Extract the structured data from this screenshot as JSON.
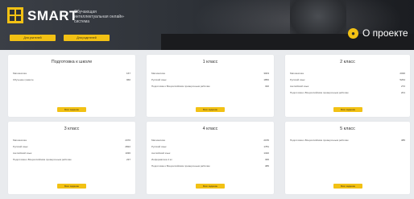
{
  "header": {
    "logo_text": "SMART",
    "logo_subtitle": "Обучающая интеллектуальная онлайн-система",
    "button_1": "Для учителей",
    "button_2": "Для родителей",
    "about_label": "О проекте",
    "about_icon": "eye-icon"
  },
  "cards": [
    {
      "title": "Подготовка к школе",
      "rows": [
        {
          "label": "Математика",
          "value": "167"
        },
        {
          "label": "Обучение грамоте",
          "value": "960"
        }
      ],
      "button": "Моё задание"
    },
    {
      "title": "1 класс",
      "rows": [
        {
          "label": "Математика",
          "value": "3003"
        },
        {
          "label": "Русский язык",
          "value": "1856"
        },
        {
          "label": "Подготовка к Всероссийским проверочным работам",
          "value": "320"
        }
      ],
      "button": "Моё задание"
    },
    {
      "title": "2 класс",
      "rows": [
        {
          "label": "Математика",
          "value": "2036"
        },
        {
          "label": "Русский язык",
          "value": "5264"
        },
        {
          "label": "Английский язык",
          "value": "272"
        },
        {
          "label": "Подготовка к Всероссийским проверочным работам",
          "value": "201"
        }
      ],
      "button": "Моё задание"
    },
    {
      "title": "3 класс",
      "rows": [
        {
          "label": "Математика",
          "value": "2370"
        },
        {
          "label": "Русский язык",
          "value": "2822"
        },
        {
          "label": "Английский язык",
          "value": "1036"
        },
        {
          "label": "Подготовка к Всероссийским проверочным работам",
          "value": "237"
        }
      ],
      "button": "Моё задание"
    },
    {
      "title": "4 класс",
      "rows": [
        {
          "label": "Математика",
          "value": "2155"
        },
        {
          "label": "Русский язык",
          "value": "1781"
        },
        {
          "label": "Английский язык",
          "value": "1320"
        },
        {
          "label": "Информатика 4 кл",
          "value": "395"
        },
        {
          "label": "Подготовка к Всероссийским проверочным работам",
          "value": "385"
        }
      ],
      "button": "Моё задание"
    },
    {
      "title": "5 класс",
      "rows": [
        {
          "label": "Подготовка к Всероссийским проверочным работам",
          "value": "385"
        }
      ],
      "button": "Моё задание"
    }
  ]
}
